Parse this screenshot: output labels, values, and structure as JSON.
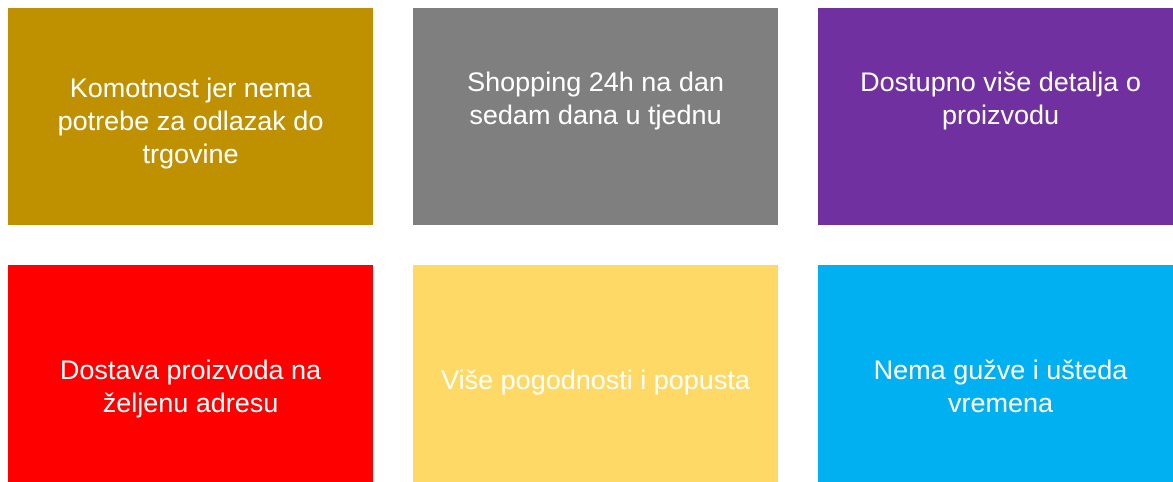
{
  "tiles": [
    {
      "text": "Komotnost jer nema potrebe za odlazak do trgovine",
      "color": "#BF9000",
      "text_color": "#FFFFFF"
    },
    {
      "text": "Shopping 24h na dan sedam dana u tjednu",
      "color": "#7F7F7F",
      "text_color": "#FFFFFF"
    },
    {
      "text": "Dostupno više detalja o proizvodu",
      "color": "#7030A0",
      "text_color": "#FFFFFF"
    },
    {
      "text": "Dostava proizvoda na željenu adresu",
      "color": "#FF0000",
      "text_color": "#FFFFFF"
    },
    {
      "text": "Više pogodnosti i popusta",
      "color": "#FFD966",
      "text_color": "#FFFFFF"
    },
    {
      "text": "Nema gužve i ušteda vremena",
      "color": "#00B0F0",
      "text_color": "#FFFFFF"
    }
  ]
}
